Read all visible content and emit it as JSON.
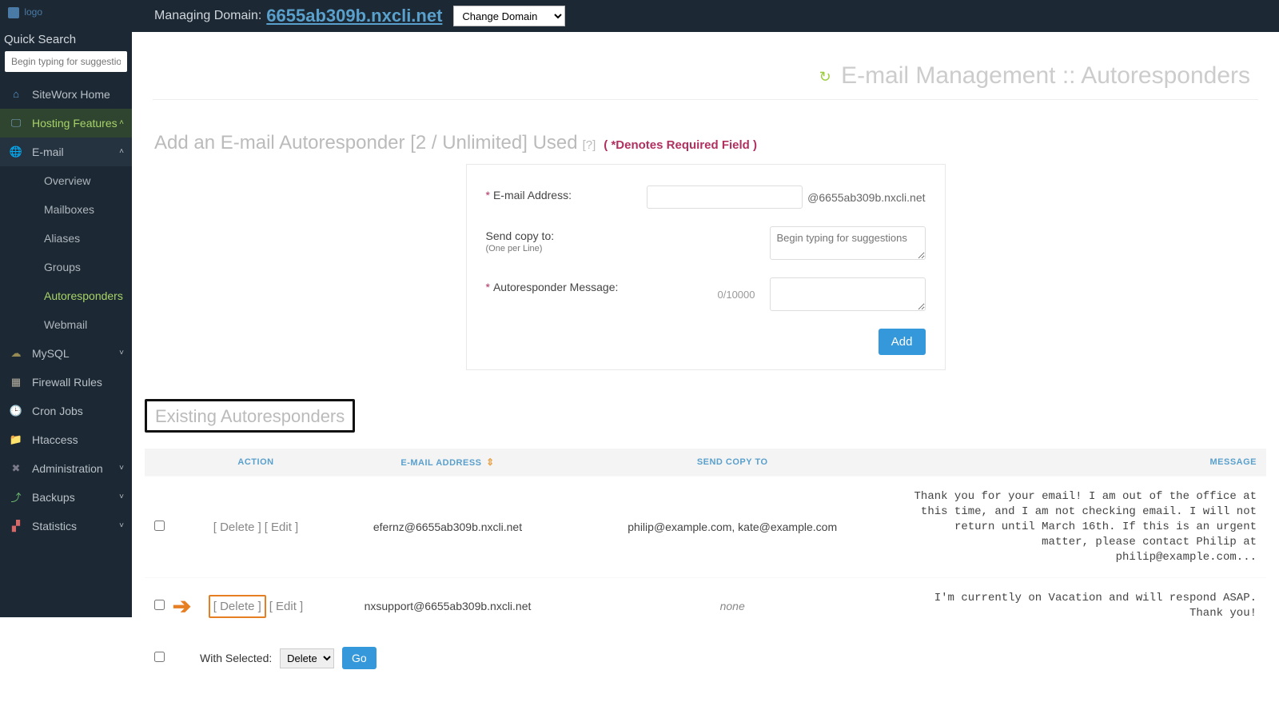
{
  "header": {
    "managing_label": "Managing Domain:",
    "domain": "6655ab309b.nxcli.net",
    "change_domain": "Change Domain"
  },
  "sidebar": {
    "logo_text": "logo",
    "quick_search_label": "Quick Search",
    "quick_search_placeholder": "Begin typing for suggestions",
    "items": {
      "home": "SiteWorx Home",
      "hosting": "Hosting Features",
      "email": "E-mail",
      "email_sub": [
        "Overview",
        "Mailboxes",
        "Aliases",
        "Groups",
        "Autoresponders",
        "Webmail"
      ],
      "mysql": "MySQL",
      "firewall": "Firewall Rules",
      "cron": "Cron Jobs",
      "htaccess": "Htaccess",
      "admin": "Administration",
      "backups": "Backups",
      "stats": "Statistics"
    }
  },
  "page": {
    "title": "E-mail Management :: Autoresponders",
    "add_heading": "Add an E-mail Autoresponder [2 / Unlimited] Used",
    "help_q": "[?]",
    "required_note": "( *Denotes Required Field )",
    "form": {
      "email_label": "E-mail Address:",
      "email_suffix": "@6655ab309b.nxcli.net",
      "copy_label": "Send copy to:",
      "copy_note": "(One per Line)",
      "copy_placeholder": "Begin typing for suggestions",
      "msg_label": "Autoresponder Message:",
      "char_count": "0/10000",
      "add_btn": "Add"
    },
    "existing_heading": "Existing Autoresponders",
    "table": {
      "headers": {
        "action": "ACTION",
        "email": "E-MAIL ADDRESS",
        "copy": "SEND COPY TO",
        "message": "MESSAGE"
      },
      "rows": [
        {
          "delete": "[ Delete ]",
          "edit": "[ Edit ]",
          "email": "efernz@6655ab309b.nxcli.net",
          "copy": "philip@example.com, kate@example.com",
          "message": "Thank you for your email! I am out of the office at this time, and I am not checking email. I will not return until March 16th. If this is an urgent matter, please contact Philip at philip@example.com...",
          "highlight": false
        },
        {
          "delete": "[ Delete ]",
          "edit": "[ Edit ]",
          "email": "nxsupport@6655ab309b.nxcli.net",
          "copy": "none",
          "message": "I'm currently on Vacation and will respond ASAP.\nThank you!",
          "highlight": true
        }
      ],
      "with_selected_label": "With Selected:",
      "select_action": "Delete",
      "go": "Go"
    }
  }
}
